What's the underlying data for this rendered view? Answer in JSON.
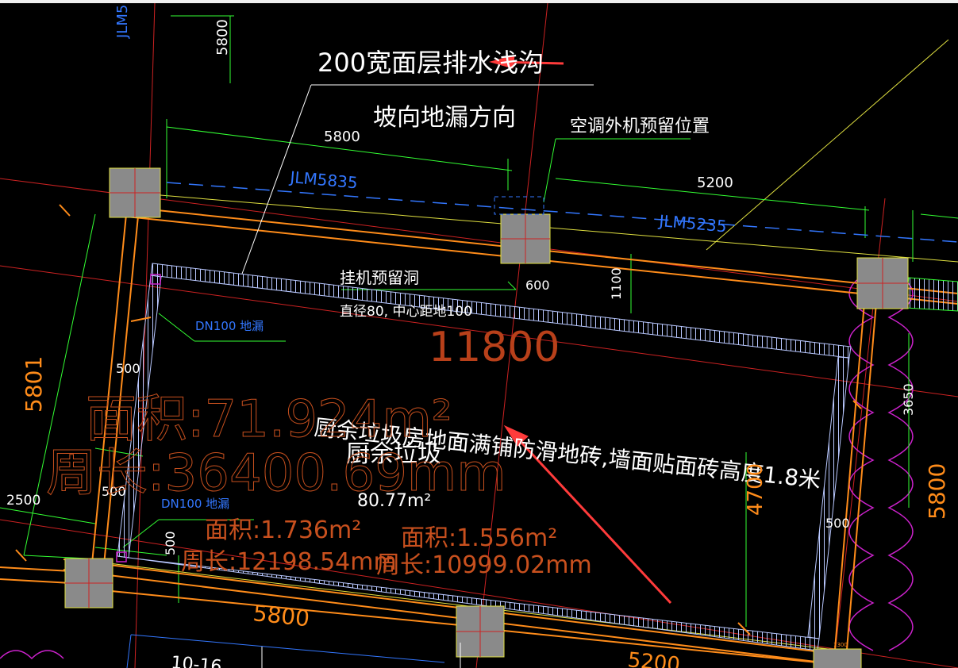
{
  "drawing": {
    "notes": {
      "drain_ditch": "200宽面层排水浅沟",
      "slope_direction": "坡向地漏方向",
      "ac_unit_position": "空调外机预留位置",
      "hang_hole": "挂机预留洞",
      "hang_hole_spec": "直径80, 中心距地100",
      "floor_finish": "厨余垃圾房地面满铺防滑地砖,墙面贴面砖高度1.8米",
      "room_name": "厨余垃圾",
      "room_area": "80.77m²"
    },
    "labels": {
      "beam_1": "JLM5835",
      "beam_2": "JLM5235",
      "beam_top": "JLM5",
      "drain_1": "DN100 地漏",
      "drain_2": "DN100 地漏"
    },
    "dimensions": {
      "d5800_top": "5800",
      "d5800_mid": "5800",
      "d5200_top": "5200",
      "d600": "600",
      "d1100": "1100",
      "d11800": "11800",
      "d3650": "3650",
      "d500_a": "500",
      "d500_b": "500",
      "d500_c": "500",
      "d500_d": "500",
      "d2500": "2500",
      "d5801": "5801",
      "d4700": "4700",
      "d5800_right": "5800",
      "d5800_bottom": "5800",
      "d5200_bottom": "5200",
      "d1300": "1300"
    },
    "measurements": {
      "area_large": "面积:71.924m²",
      "perimeter_large": "周长:36400.69mm",
      "area_small_1": "面积:1.736m²",
      "area_small_2": "面积:1.556m²",
      "perimeter_small_1": "周长:12198.54mm",
      "perimeter_small_2": "周长:10999.02mm",
      "grid_bottom": "10-16"
    },
    "colors": {
      "background": "#000000",
      "wall": "#ff8c1a",
      "dimension_line": "#33ff33",
      "grid_axis": "#cc2222",
      "beam_label": "#3377ff",
      "measurement": "#c8501e",
      "arrow": "#ff3b3b",
      "hatch": "#b9c8ff",
      "column": "#8a8a8a"
    }
  }
}
